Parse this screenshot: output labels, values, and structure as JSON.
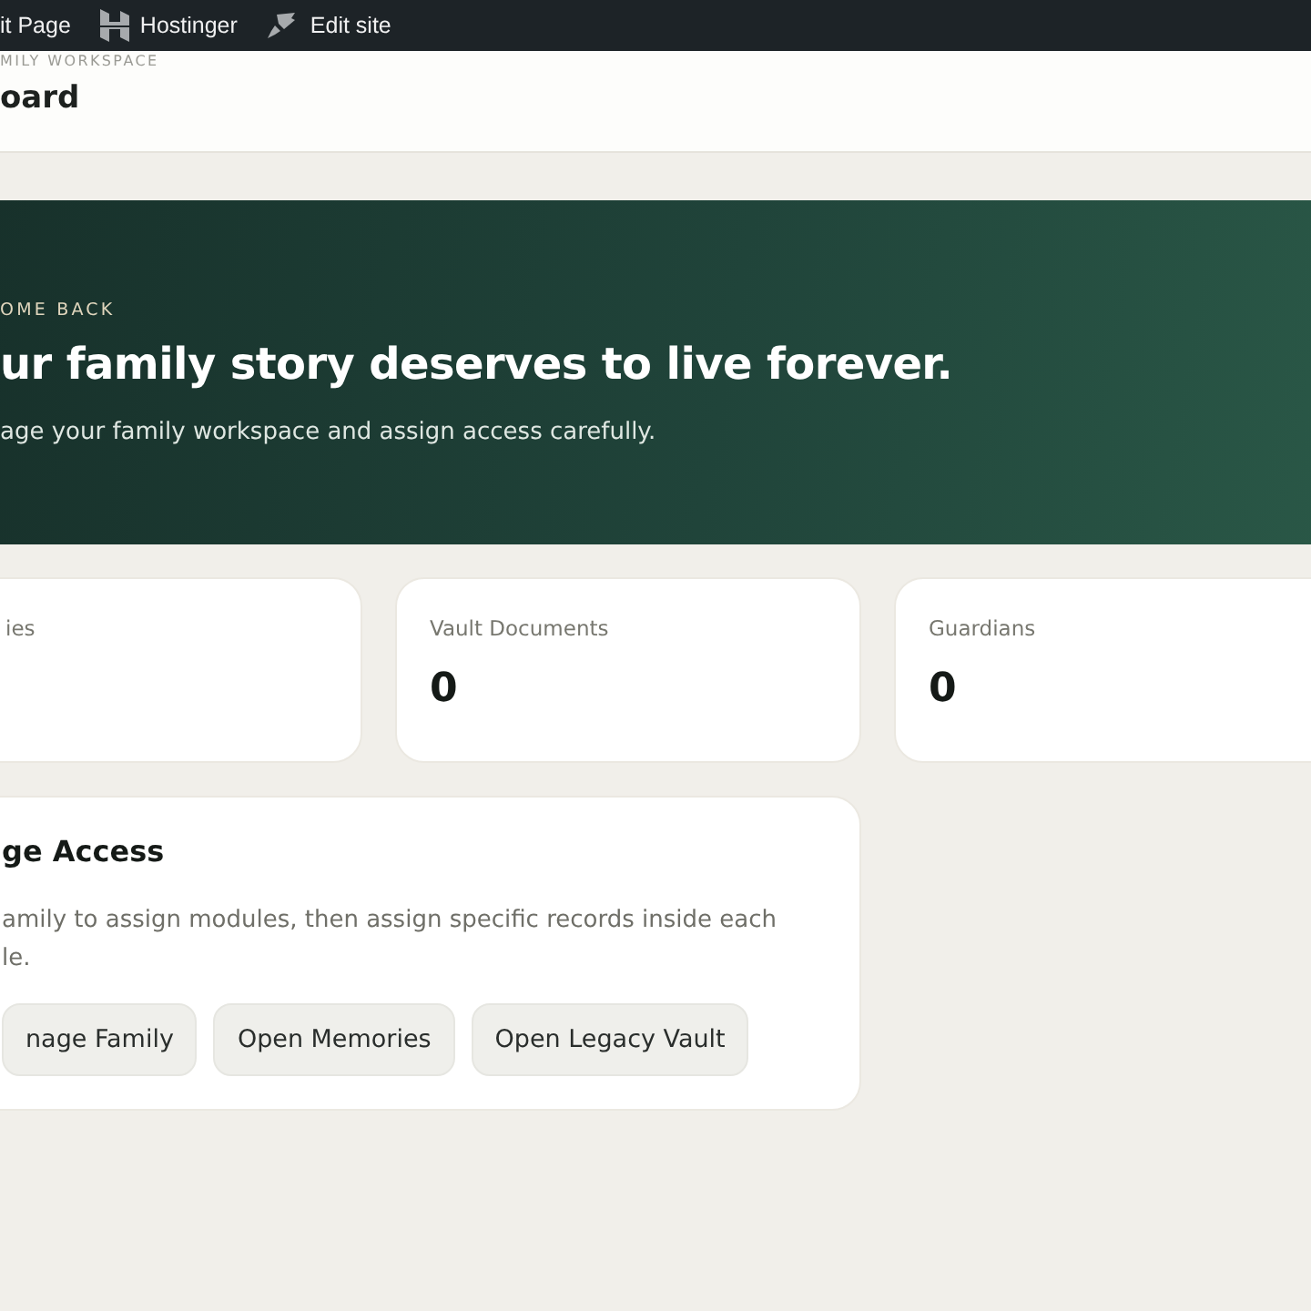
{
  "admin_bar": {
    "items": [
      {
        "kind": "text",
        "label": "it Page"
      },
      {
        "kind": "hostinger",
        "label": "Hostinger"
      },
      {
        "kind": "brush",
        "label": "Edit site"
      }
    ]
  },
  "header": {
    "eyebrow": "MILY WORKSPACE",
    "title": "oard"
  },
  "hero": {
    "eyebrow": "OME BACK",
    "title": "ur family story deserves to live forever.",
    "subtitle": "age your family workspace and assign access carefully."
  },
  "stats": [
    {
      "label": "ies"
    },
    {
      "label": "Vault Documents",
      "value": "0"
    },
    {
      "label": "Guardians",
      "value": "0"
    }
  ],
  "access_card": {
    "title": "ge Access",
    "description": "amily to assign modules, then assign specific records inside each\nle.",
    "buttons": [
      "nage Family",
      "Open Memories",
      "Open Legacy Vault"
    ]
  }
}
